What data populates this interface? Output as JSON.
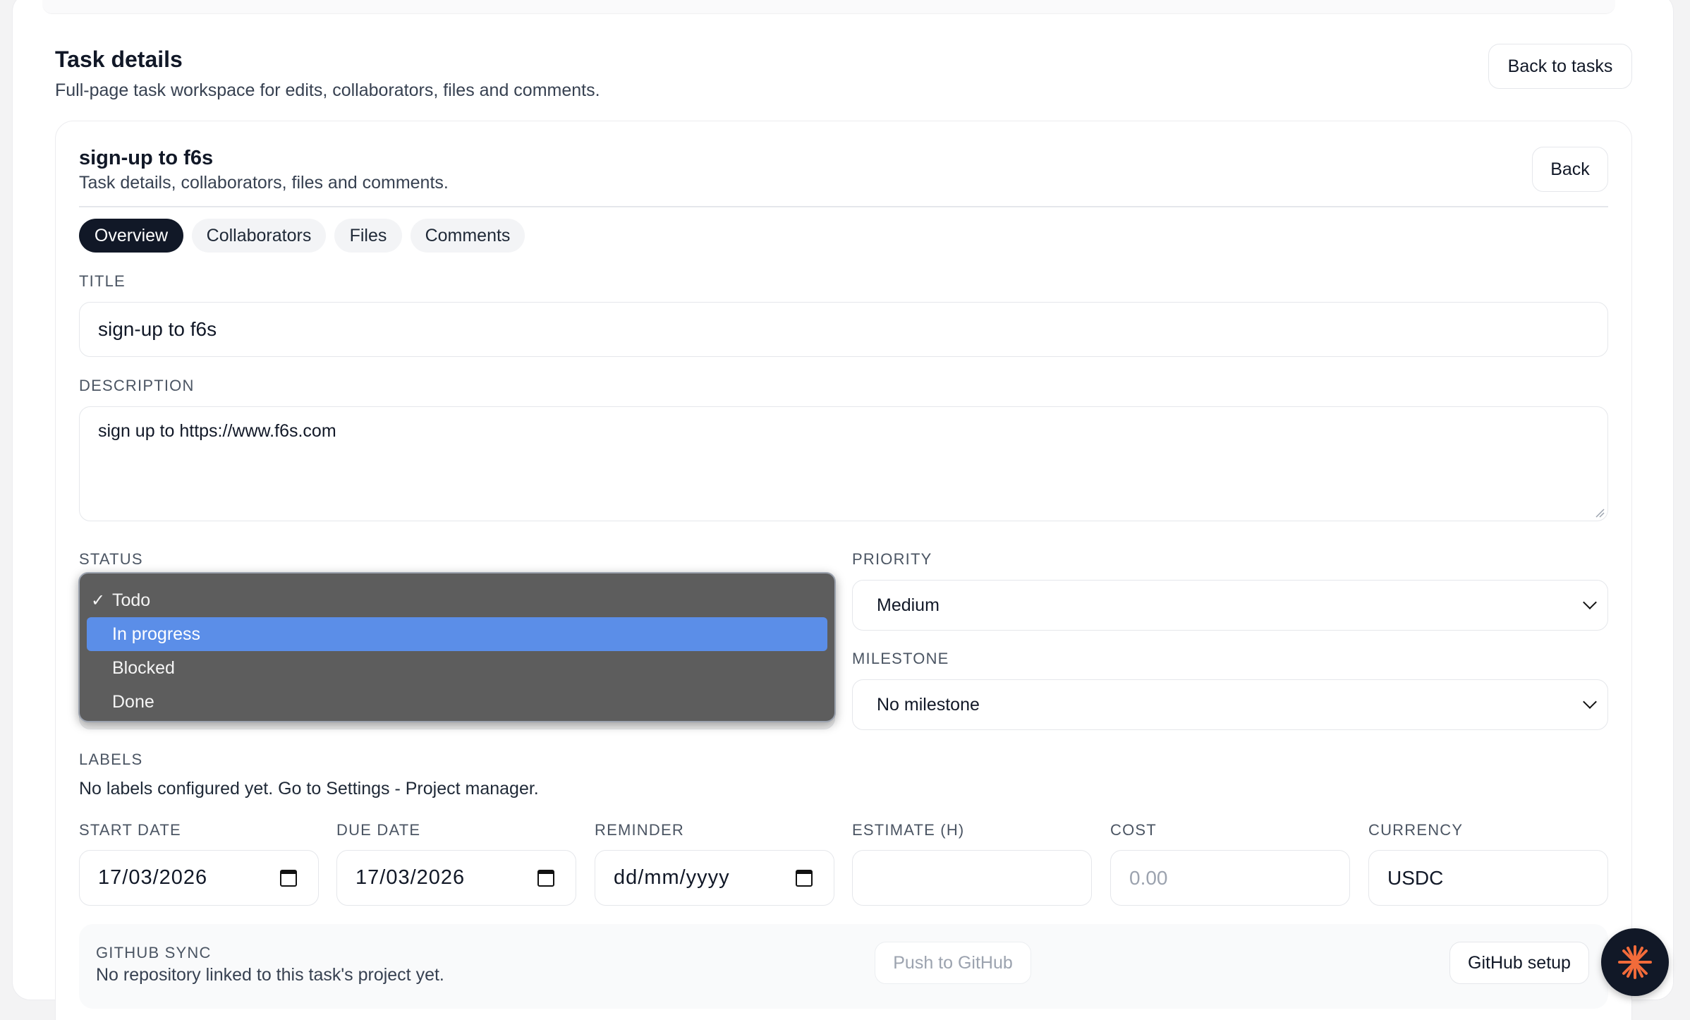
{
  "page": {
    "title": "Task details",
    "subtitle": "Full-page task workspace for edits, collaborators, files and comments.",
    "back_to_tasks_label": "Back to tasks"
  },
  "task_card": {
    "title": "sign-up to f6s",
    "subtitle": "Task details, collaborators, files and comments.",
    "back_label": "Back"
  },
  "tabs": [
    {
      "label": "Overview",
      "active": true
    },
    {
      "label": "Collaborators",
      "active": false
    },
    {
      "label": "Files",
      "active": false
    },
    {
      "label": "Comments",
      "active": false
    }
  ],
  "form": {
    "title_label": "TITLE",
    "title_value": "sign-up to f6s",
    "description_label": "DESCRIPTION",
    "description_value": "sign up to https://www.f6s.com",
    "status_label": "STATUS",
    "status_options": [
      "Todo",
      "In progress",
      "Blocked",
      "Done"
    ],
    "status_selected": "Todo",
    "status_highlighted": "In progress",
    "priority_label": "PRIORITY",
    "priority_value": "Medium",
    "milestone_label": "MILESTONE",
    "milestone_value": "No milestone",
    "labels_label": "LABELS",
    "labels_text": "No labels configured yet. Go to Settings - Project manager.",
    "start_date_label": "START DATE",
    "start_date_value": "17/03/2026",
    "due_date_label": "DUE DATE",
    "due_date_value": "17/03/2026",
    "reminder_label": "REMINDER",
    "reminder_placeholder": "dd/mm/yyyy",
    "estimate_label": "ESTIMATE (H)",
    "estimate_value": "",
    "cost_label": "COST",
    "cost_placeholder": "0.00",
    "currency_label": "CURRENCY",
    "currency_value": "USDC"
  },
  "github": {
    "label": "GITHUB SYNC",
    "status_text": "No repository linked to this task's project yet.",
    "push_label": "Push to GitHub",
    "setup_label": "GitHub setup"
  },
  "icons": {
    "check": "✓",
    "fab": "asterisk-logo-icon"
  },
  "colors": {
    "accent_dark": "#111827",
    "highlight": "#5b8ee8",
    "fab_orange": "#f26b3a"
  }
}
